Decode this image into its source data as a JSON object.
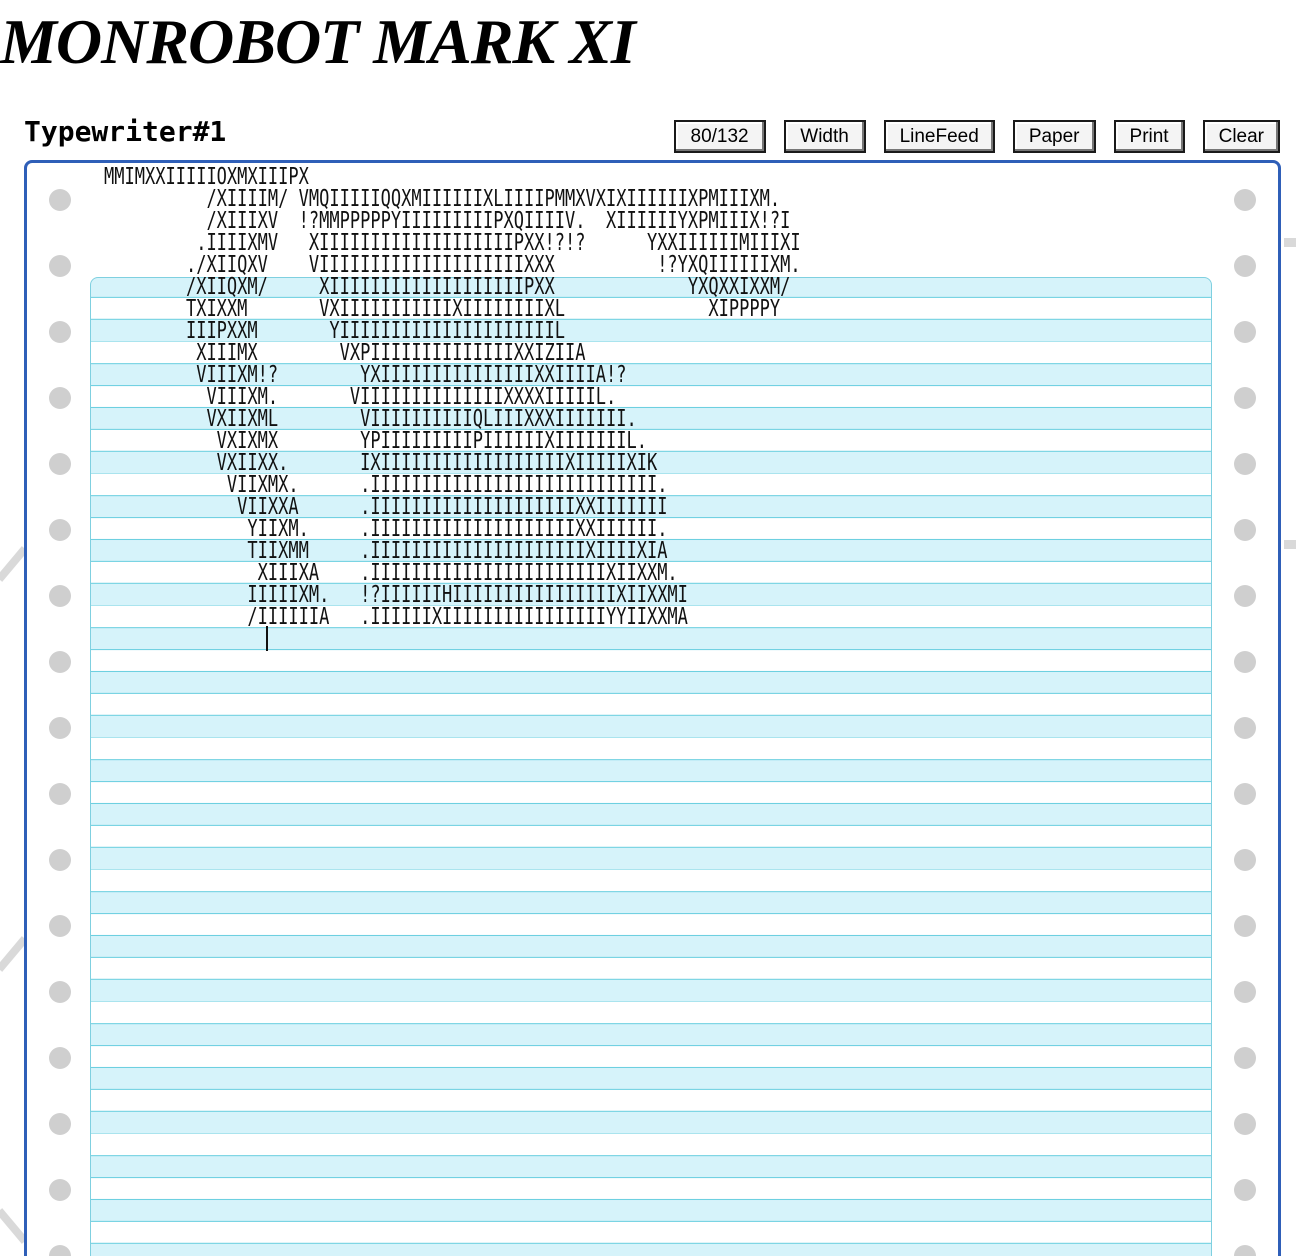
{
  "app": {
    "title": "MONROBOT MARK XI"
  },
  "typewriter": {
    "title": "Typewriter#1",
    "buttons": {
      "width_mode": "80/132",
      "width": "Width",
      "linefeed": "LineFeed",
      "paper": "Paper",
      "print": "Print",
      "clear": "Clear"
    },
    "printout_lines": [
      "MMIMXXIIIIIOXMXIIIPX",
      "          /XIIIIM/ VMQIIIIIQQXMIIIIIIXLIIIIPMMXVXIXIIIIIIXPMIIIXM.",
      "          /XIIIXV  !?MMPPPPPYIIIIIIIIIPXQIIIIV.  XIIIIIIYXPMIIIX!?I",
      "         .IIIIXMV   XIIIIIIIIIIIIIIIIIIIPXX!?!?      YXXIIIIIIMIIIXI",
      "        ./XIIQXV    VIIIIIIIIIIIIIIIIIIIIXXX          !?YXQIIIIIIXM.",
      "        /XIIQXM/     XIIIIIIIIIIIIIIIIIIIPXX             YXQXXIXXM/",
      "        TXIXXM       VXIIIIIIIIIIIXIIIIIIIIXL              XIPPPPY",
      "        IIIPXXM       YIIIIIIIIIIIIIIIIIIIIIL",
      "         XIIIMX        VXPIIIIIIIIIIIIIIXXIZIIA",
      "         VIIIXM!?        YXIIIIIIIIIIIIIIIXXIIIIA!?",
      "          VIIIXM.       VIIIIIIIIIIIIIIXXXXIIIIIL.",
      "          VXIIXML        VIIIIIIIIIIQLIIIXXXIIIIIII.",
      "           VXIXMX        YPIIIIIIIIIPIIIIIIXIIIIIIIL.",
      "           VXIIXX.       IXIIIIIIIIIIIIIIIIIIXIIIIIXIK",
      "            VIIXMX.      .IIIIIIIIIIIIIIIIIIIIIIIIIIII.",
      "             VIIXXA      .IIIIIIIIIIIIIIIIIIIIXXIIIIIII",
      "              YIIXM.     .IIIIIIIIIIIIIIIIIIIIXXIIIIII.",
      "              TIIXMM     .IIIIIIIIIIIIIIIIIIIIIXIIIIXIA",
      "               XIIIXA    .IIIIIIIIIIIIIIIIIIIIIIIXIIXXM.",
      "              IIIIIXM.   !?IIIIIIHIIIIIIIIIIIIIIIIXIIXXMI",
      "              /IIIIIIA   .IIIIIIXIIIIIIIIIIIIIIIIYYIIXXMA"
    ]
  },
  "colors": {
    "frame_border": "#2f5fb8",
    "paper_stripe": "#d6f3fa",
    "paper_rule": "#6ccfe0",
    "sprocket": "#cfcfcf"
  }
}
